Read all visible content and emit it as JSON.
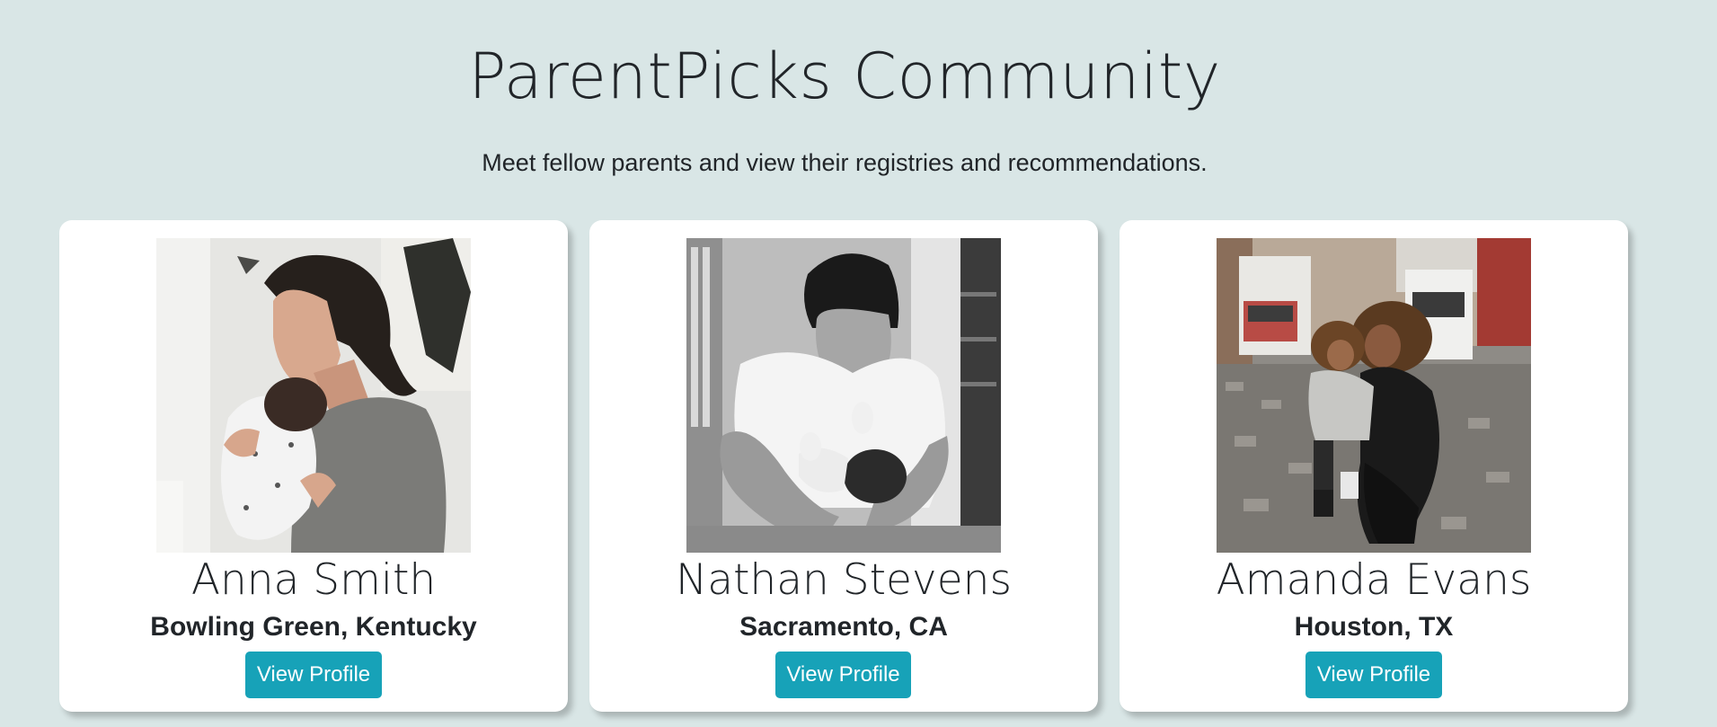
{
  "header": {
    "title": "ParentPicks Community",
    "subtitle": "Meet fellow parents and view their registries and recommendations."
  },
  "profiles": [
    {
      "name": "Anna Smith",
      "location": "Bowling Green, Kentucky",
      "button_label": "View Profile",
      "photo": "mother-holding-newborn-photo"
    },
    {
      "name": "Nathan Stevens",
      "location": "Sacramento, CA",
      "button_label": "View Profile",
      "photo": "father-holding-newborn-bw-photo"
    },
    {
      "name": "Amanda Evans",
      "location": "Houston, TX",
      "button_label": "View Profile",
      "photo": "mother-and-child-street-photo"
    }
  ],
  "colors": {
    "background": "#d9e6e6",
    "card": "#ffffff",
    "button": "#17a2b8",
    "text": "#212529"
  }
}
